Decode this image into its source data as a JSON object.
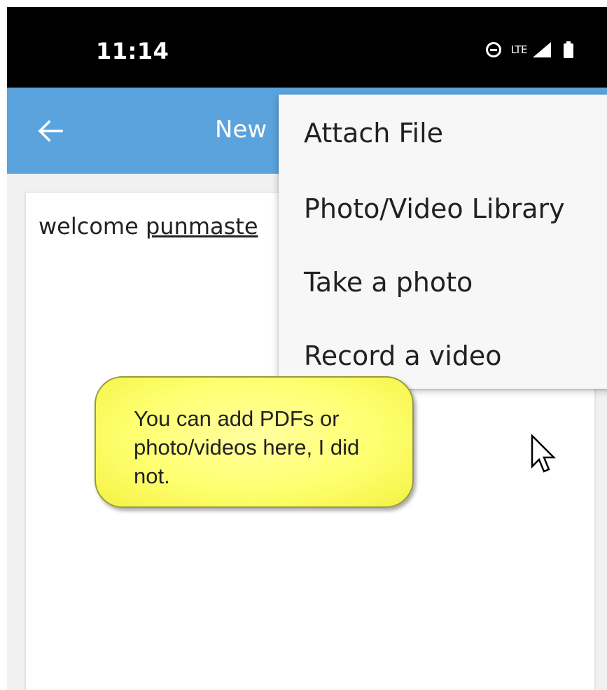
{
  "status_bar": {
    "time": "11:14",
    "network": "LTE",
    "icons": [
      "do-not-disturb-icon",
      "signal-icon",
      "battery-icon"
    ]
  },
  "app_bar": {
    "back_icon": "arrow-left-icon",
    "title": "New"
  },
  "content": {
    "welcome_prefix": "welcome ",
    "username": "punmaste"
  },
  "menu": {
    "items": [
      {
        "label": "Attach File"
      },
      {
        "label": "Photo/Video Library"
      },
      {
        "label": "Take a photo"
      },
      {
        "label": "Record a video"
      }
    ]
  },
  "callout": {
    "text": "You can add PDFs or photo/videos here, I did not."
  },
  "colors": {
    "app_bar": "#5ba3dd",
    "status_bar": "#000000",
    "callout_fill": "#ffff70",
    "menu_background": "#f7f7f7"
  }
}
